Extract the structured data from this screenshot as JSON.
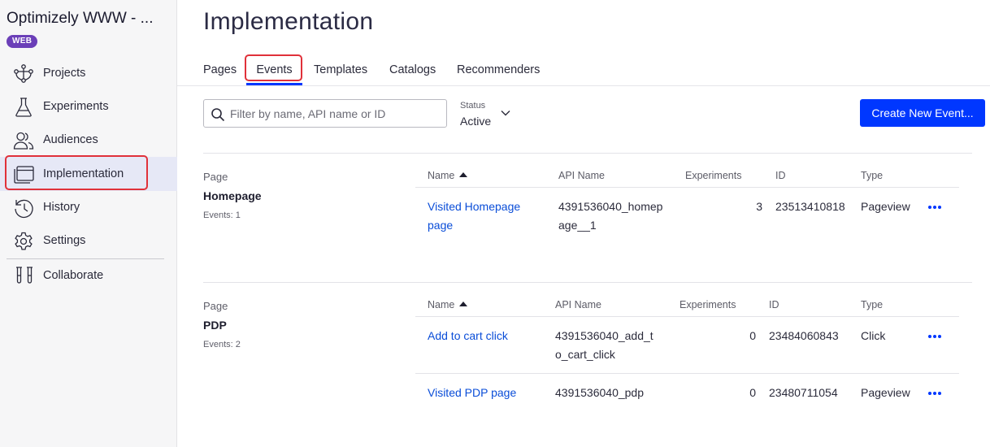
{
  "sidebar": {
    "project_title": "Optimizely WWW - ...",
    "badge": "WEB",
    "items": [
      {
        "label": "Projects",
        "icon": "projects-icon"
      },
      {
        "label": "Experiments",
        "icon": "flask-icon"
      },
      {
        "label": "Audiences",
        "icon": "users-icon"
      },
      {
        "label": "Implementation",
        "icon": "implementation-icon",
        "active": true
      },
      {
        "label": "History",
        "icon": "history-icon"
      },
      {
        "label": "Settings",
        "icon": "gear-icon"
      },
      {
        "label": "Collaborate",
        "icon": "test-tubes-icon"
      }
    ]
  },
  "main": {
    "title": "Implementation",
    "tabs": [
      {
        "label": "Pages"
      },
      {
        "label": "Events",
        "active": true
      },
      {
        "label": "Templates"
      },
      {
        "label": "Catalogs"
      },
      {
        "label": "Recommenders"
      }
    ],
    "search": {
      "placeholder": "Filter by name, API name or ID",
      "value": ""
    },
    "status": {
      "caption": "Status",
      "value": "Active"
    },
    "create_button": "Create New Event..."
  },
  "groups": [
    {
      "label": "Page",
      "name": "Homepage",
      "count": "Events: 1",
      "headers": {
        "name": "Name",
        "api": "API Name",
        "experiments": "Experiments",
        "id": "ID",
        "type": "Type"
      },
      "rows": [
        {
          "name_l1": "Visited Homepage",
          "name_l2": "page",
          "api_l1": "4391536040_homep",
          "api_l2": "age__1",
          "experiments": "3",
          "id": "23513410818",
          "type": "Pageview"
        }
      ]
    },
    {
      "label": "Page",
      "name": "PDP",
      "count": "Events: 2",
      "headers": {
        "name": "Name",
        "api": "API Name",
        "experiments": "Experiments",
        "id": "ID",
        "type": "Type"
      },
      "rows": [
        {
          "name_l1": "Add to cart click",
          "api_l1": "4391536040_add_t",
          "api_l2": "o_cart_click",
          "experiments": "0",
          "id": "23484060843",
          "type": "Click"
        },
        {
          "name_l1": "Visited PDP page",
          "api_l1": "4391536040_pdp",
          "experiments": "0",
          "id": "23480711054",
          "type": "Pageview"
        }
      ]
    }
  ],
  "colors": {
    "accent": "#0037ff",
    "link": "#0a4dd8",
    "highlight": "#e0313a",
    "badge": "#6b3fb8"
  }
}
